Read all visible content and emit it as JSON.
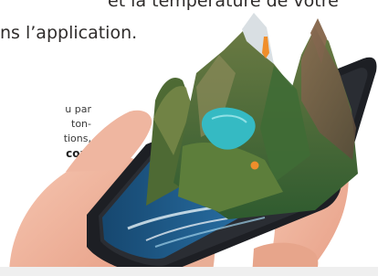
{
  "headline": {
    "line1": "et la température de votre",
    "line2": "ns l’application."
  },
  "sidebar": {
    "lines": [
      "u par",
      "ton-",
      "tions,",
      "com"
    ]
  },
  "illustration": {
    "icons": [
      "hand-icon",
      "smartphone-icon",
      "mountain-icon",
      "lake-icon",
      "location-pin-icon"
    ],
    "colors": {
      "skin": "#f2b79f",
      "phone": "#1f2126",
      "lake": "#31b7c1",
      "sea": "#2b6fa6",
      "pin": "#f08e2b"
    }
  }
}
